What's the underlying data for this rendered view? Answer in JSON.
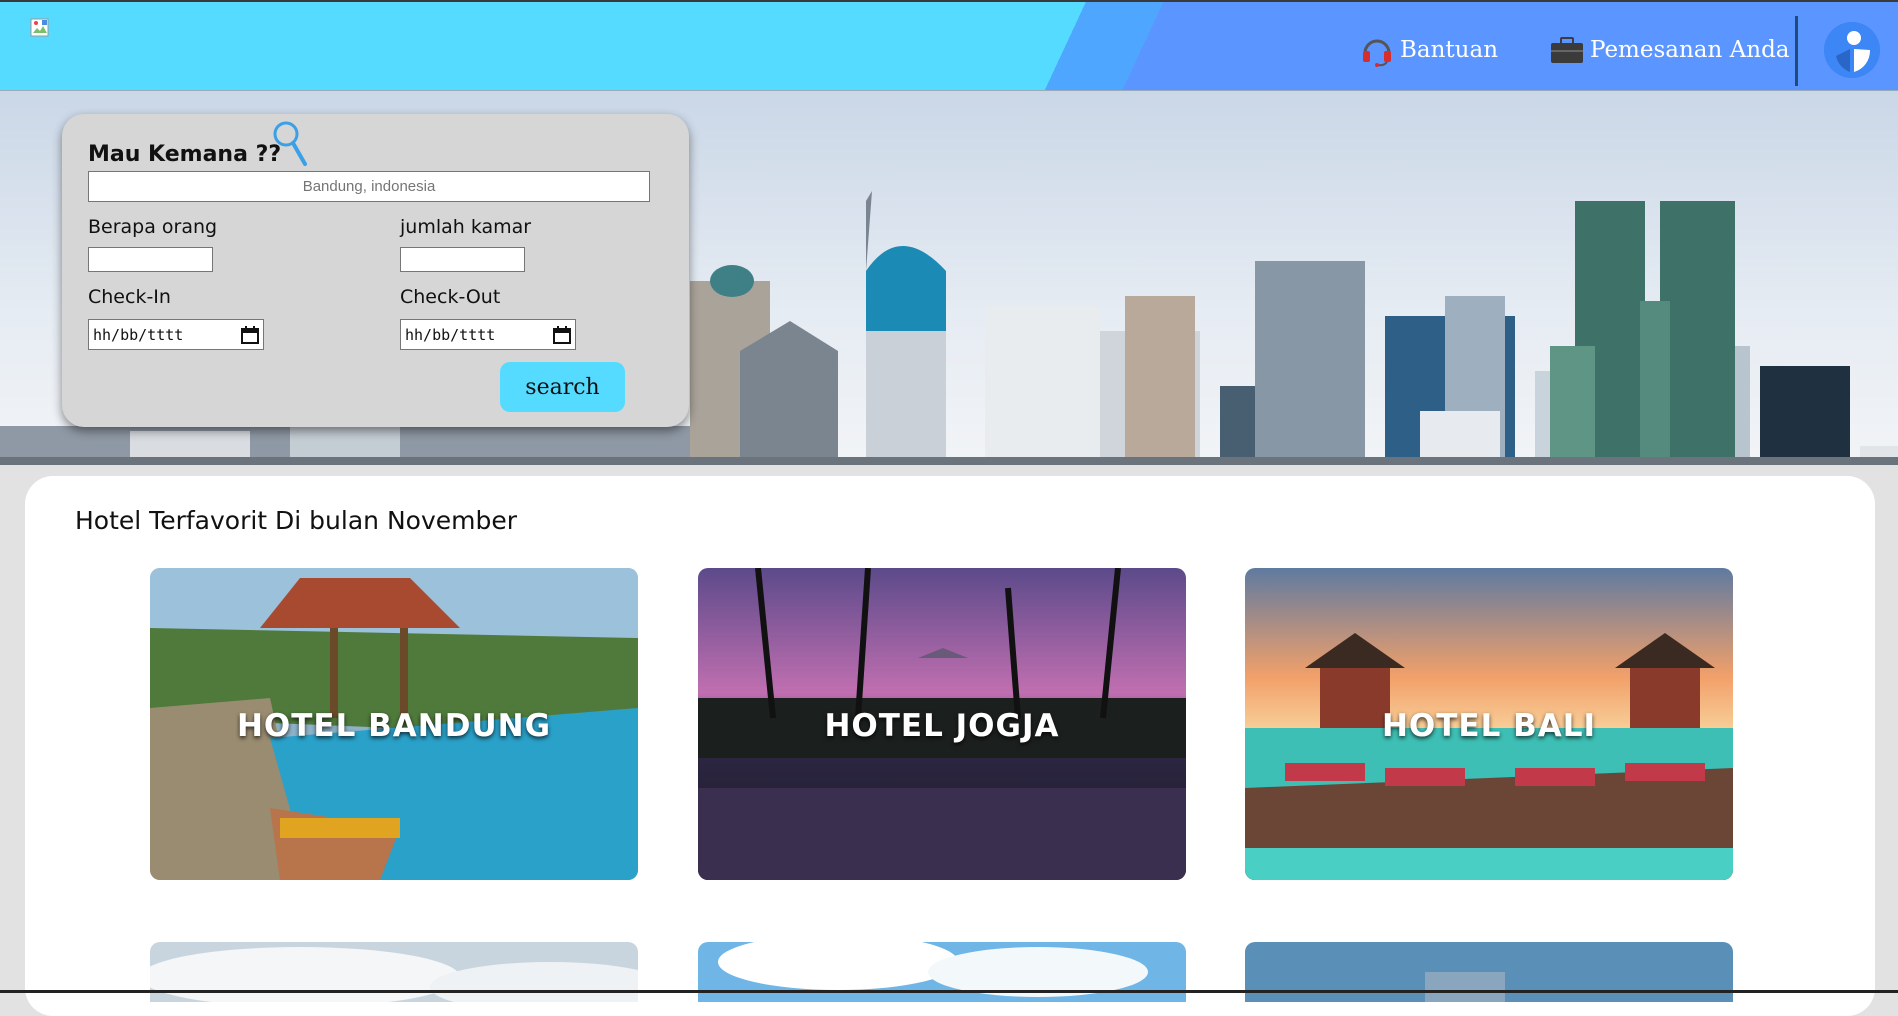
{
  "header": {
    "logo_alt": "",
    "nav": {
      "help_label": "Bantuan",
      "orders_label": "Pemesanan Anda"
    },
    "icons": {
      "help": "headset-icon",
      "orders": "briefcase-icon",
      "avatar": "user-avatar-icon"
    },
    "colors": {
      "primary": "#55dbff",
      "secondary": "#5b95ff"
    }
  },
  "search": {
    "title": "Mau Kemana ??",
    "destination_placeholder": "Bandung, indonesia",
    "guests_label": "Berapa orang",
    "guests_value": "",
    "rooms_label": "jumlah kamar",
    "rooms_value": "",
    "checkin_label": "Check-In",
    "checkin_value": "hh/bb/tttt",
    "checkout_label": "Check-Out",
    "checkout_value": "hh/bb/tttt",
    "button_label": "search",
    "icons": {
      "search": "magnifier-icon",
      "calendar": "calendar-icon"
    }
  },
  "favorites": {
    "title": "Hotel Terfavorit Di bulan November",
    "cards": [
      {
        "label": "HOTEL BANDUNG"
      },
      {
        "label": "HOTEL JOGJA"
      },
      {
        "label": "HOTEL BALI"
      }
    ]
  }
}
